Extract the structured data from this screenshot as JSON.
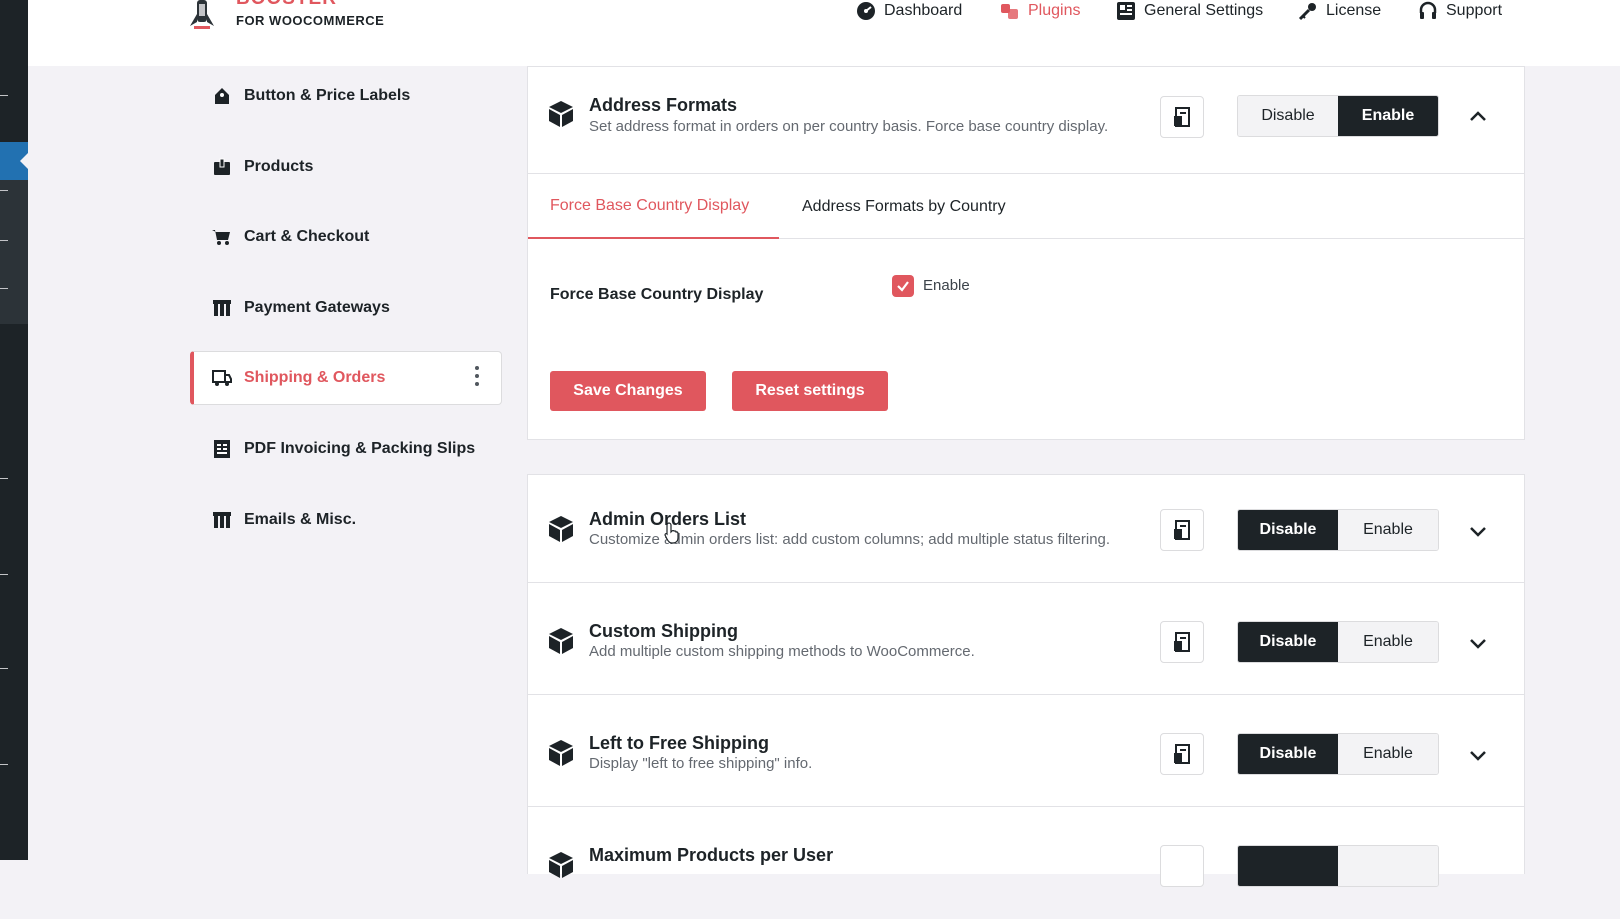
{
  "brand": {
    "top": "BOOSTER",
    "bottom": "FOR WOOCOMMERCE"
  },
  "nav": [
    {
      "label": "Dashboard",
      "icon": "dashboard-icon"
    },
    {
      "label": "Plugins",
      "icon": "plugins-icon"
    },
    {
      "label": "General Settings",
      "icon": "settings-grid-icon"
    },
    {
      "label": "License",
      "icon": "key-icon"
    },
    {
      "label": "Support",
      "icon": "headphones-icon"
    }
  ],
  "sidebar": {
    "items": [
      {
        "label": "Button & Price Labels",
        "icon": "tag-icon"
      },
      {
        "label": "Products",
        "icon": "box-icon"
      },
      {
        "label": "Cart & Checkout",
        "icon": "cart-icon"
      },
      {
        "label": "Payment Gateways",
        "icon": "gateway-icon"
      },
      {
        "label": "Shipping & Orders",
        "icon": "truck-icon"
      },
      {
        "label": "PDF Invoicing & Packing Slips",
        "icon": "invoice-icon"
      },
      {
        "label": "Emails & Misc.",
        "icon": "misc-icon"
      }
    ]
  },
  "address_formats": {
    "title": "Address Formats",
    "desc": "Set address format in orders on per country basis. Force base country display.",
    "tabs": [
      "Force Base Country Display",
      "Address Formats by Country"
    ],
    "field_label": "Force Base Country Display",
    "checkbox_label": "Enable",
    "save_label": "Save Changes",
    "reset_label": "Reset settings"
  },
  "toggle": {
    "disable": "Disable",
    "enable": "Enable"
  },
  "modules": [
    {
      "title": "Admin Orders List",
      "desc": "Customize admin orders list: add custom columns; add multiple status filtering."
    },
    {
      "title": "Custom Shipping",
      "desc": "Add multiple custom shipping methods to WooCommerce."
    },
    {
      "title": "Left to Free Shipping",
      "desc": "Display \"left to free shipping\" info."
    },
    {
      "title": "Maximum Products per User",
      "desc": ""
    }
  ],
  "colors": {
    "accent": "#e0575e",
    "dark": "#1d2327"
  }
}
